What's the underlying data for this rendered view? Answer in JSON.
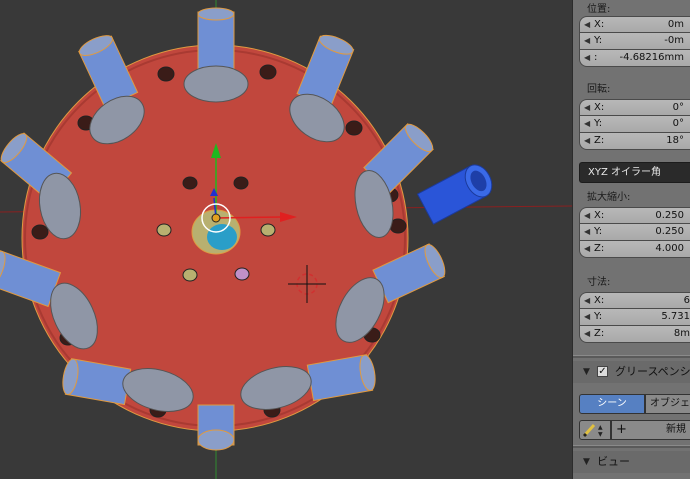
{
  "panel": {
    "location": {
      "label": "位置:",
      "fields": [
        {
          "axis": "X:",
          "value": "0m"
        },
        {
          "axis": "Y:",
          "value": "-0m"
        },
        {
          "axis": ":",
          "value": "-4.68216mm"
        }
      ]
    },
    "rotation": {
      "label": "回転:",
      "fields": [
        {
          "axis": "X:",
          "value": "0°"
        },
        {
          "axis": "Y:",
          "value": "0°"
        },
        {
          "axis": "Z:",
          "value": "18°"
        }
      ],
      "mode": "XYZ オイラー角"
    },
    "scale": {
      "label": "拡大縮小:",
      "fields": [
        {
          "axis": "X:",
          "value": "0.250"
        },
        {
          "axis": "Y:",
          "value": "0.250"
        },
        {
          "axis": "Z:",
          "value": "4.000"
        }
      ]
    },
    "dimensions": {
      "label": "寸法:",
      "fields": [
        {
          "axis": "X:",
          "value": "6"
        },
        {
          "axis": "Y:",
          "value": "5.731"
        },
        {
          "axis": "Z:",
          "value": "8m"
        }
      ]
    },
    "grease_pencil": {
      "title": "グリースペンシ",
      "checked": "✓",
      "tab_scene": "シーン",
      "tab_object": "オブジェ",
      "new_label": "新規",
      "plus": "+"
    },
    "view": {
      "title": "ビュー"
    }
  },
  "colors": {
    "plate": "#c1473d",
    "post_side": "#6f8fd4",
    "post_top": "#8a9ec9",
    "disc": "#8f96a6",
    "selected_post": "#2a55d8",
    "axis_x": "#e02020",
    "axis_y": "#1fb81f",
    "axis_z": "#2030d0"
  },
  "icons": {
    "collapse": "triangle-down-icon",
    "pencil": "pencil-icon",
    "cursor": "3d-cursor-icon"
  }
}
